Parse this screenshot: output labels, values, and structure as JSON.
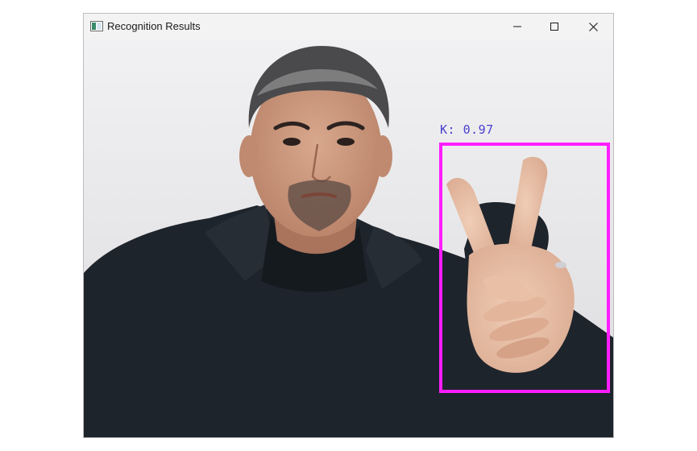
{
  "window": {
    "title": "Recognition Results",
    "app_icon": "opencv-window-icon",
    "controls": {
      "minimize_icon": "minimize-icon",
      "maximize_icon": "maximize-icon",
      "close_icon": "close-icon"
    }
  },
  "detection": {
    "label": "K: 0.97",
    "box_color": "#ff1dff",
    "label_color": "#4b3fcf"
  }
}
